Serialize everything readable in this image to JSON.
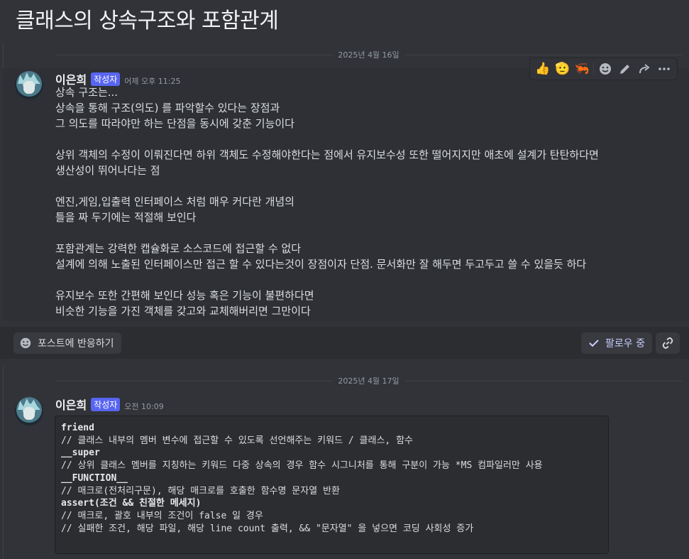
{
  "page_title": "클래스의 상속구조와 포함관계",
  "messages": [
    {
      "date_divider": "2025년 4월 16일",
      "author": "이은희",
      "author_tag": "작성자",
      "timestamp": "어제 오후 11:25",
      "lines": [
        "상속 구조는...",
        "상속을 통해 구조(의도) 를 파악할수 있다는 장점과",
        "그 의도를 따라야만 하는 단점을 동시에 갖춘 기능이다",
        "",
        "상위 객체의 수정이 이뤄진다면 하위 객체도 수정해야한다는 점에서 유지보수성 또한 떨어지지만 애초에 설계가 탄탄하다면",
        "생산성이 뛰어나다는 점",
        "",
        "엔진,게임,입출력 인터페이스 처럼 매우 커다란 개념의",
        "틀을 짜 두기에는 적절해 보인다",
        "",
        "포함관계는 강력한 캡슐화로 소스코드에 접근할 수 없다",
        "설계에 의해 노출된 인터페이스만 접근 할 수 있다는것이 장점이자 단점. 문서화만 잘 해두면 두고두고 쓸 수 있을듯 하다",
        "",
        "유지보수 또한 간편해 보인다 성능 혹은 기능이 불편하다면",
        "비슷한 기능을 가진 객체를 갖고와 교체해버리면 그만이다"
      ]
    },
    {
      "date_divider": "2025년 4월 17일",
      "author": "이은희",
      "author_tag": "작성자",
      "timestamp": "오전 10:09",
      "code_lines": [
        "friend",
        "// 클래스 내부의 멤버 변수에 접근할 수 있도록 선언해주는 키워드 / 클래스, 함수",
        "__super",
        "// 상위 클래스 멤버를 지칭하는 키워드 다중 상속의 경우 함수 시그니처를 통해 구분이 가능 *MS 컴파일러만 사용",
        "__FUNCTION__",
        "// 매크로(전처리구문), 해당 매크로를 호출한 함수명 문자열 반환",
        "assert(조건 && 친절한 메세지)",
        "// 매크로, 괄호 내부의 조건이 false 일 경우",
        "// 실패한 조건, 해당 파일, 해당 line count 출력, && \"문자열\" 을 넣으면 코딩 사회성 증가"
      ]
    }
  ],
  "hover_toolbar": {
    "reactions": [
      "👍",
      "🫡",
      "🦐"
    ],
    "icons": [
      "add-reaction-icon",
      "edit-icon",
      "forward-icon",
      "more-icon"
    ]
  },
  "post_footer": {
    "react_label": "포스트에 반응하기",
    "follow_label": "팔로우 중"
  },
  "colors": {
    "background": "#313338",
    "author_tag": "#5865f2",
    "follow_text": "#c9cdfb"
  }
}
